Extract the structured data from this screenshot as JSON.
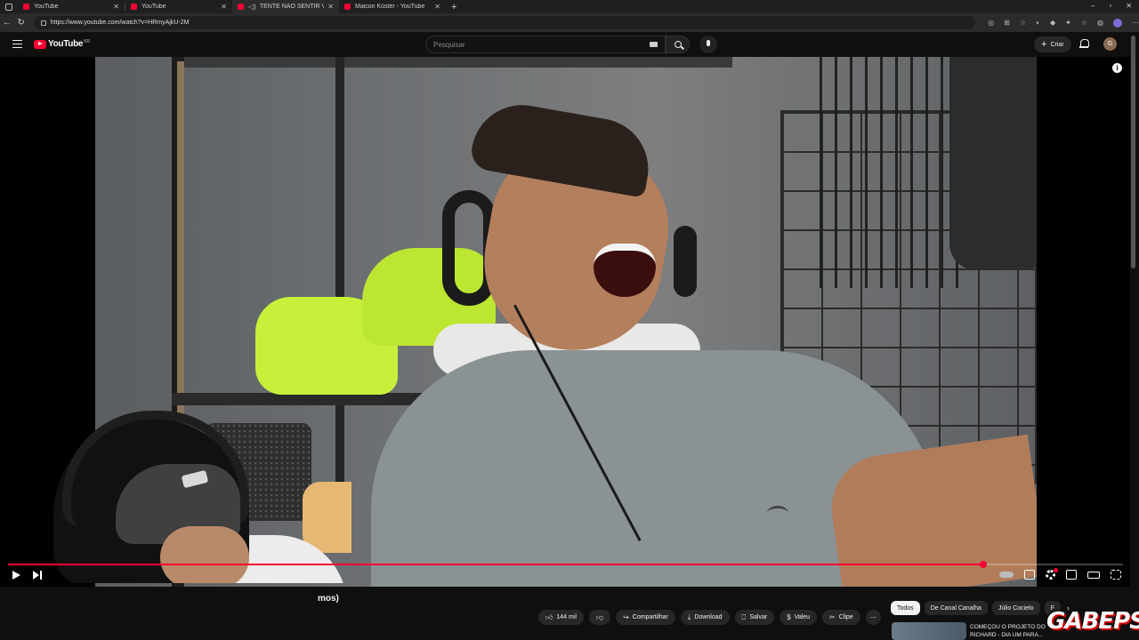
{
  "browser": {
    "tabs": [
      {
        "title": "YouTube",
        "active": false
      },
      {
        "title": "YouTube",
        "active": false
      },
      {
        "title": "TENTE NÃO SENTIR VERGO...",
        "active": true
      },
      {
        "title": "Maicon Küster - YouTube",
        "active": false
      }
    ],
    "url": "https://www.youtube.com/watch?v=HRmyAjkU-2M"
  },
  "youtube": {
    "logo_text": "YouTube",
    "country_code": "BR",
    "search_placeholder": "Pesquisar",
    "create_label": "Criar",
    "user_initial": "G"
  },
  "player": {
    "progress_fraction": 0.875
  },
  "video": {
    "title_fragment": "mos)"
  },
  "actions": {
    "likes": "144 mil",
    "share": "Compartilhar",
    "download": "Download",
    "save": "Salvar",
    "thanks": "Valeu",
    "clip": "Clipe"
  },
  "chips": [
    "Todos",
    "De Canal Canalha",
    "Júlio Cocielo",
    "F"
  ],
  "recommendation": {
    "title": "COMEÇOU O PROJETO DO RICHARD - DIA UM PARA..."
  },
  "watermark": "GABEPS"
}
